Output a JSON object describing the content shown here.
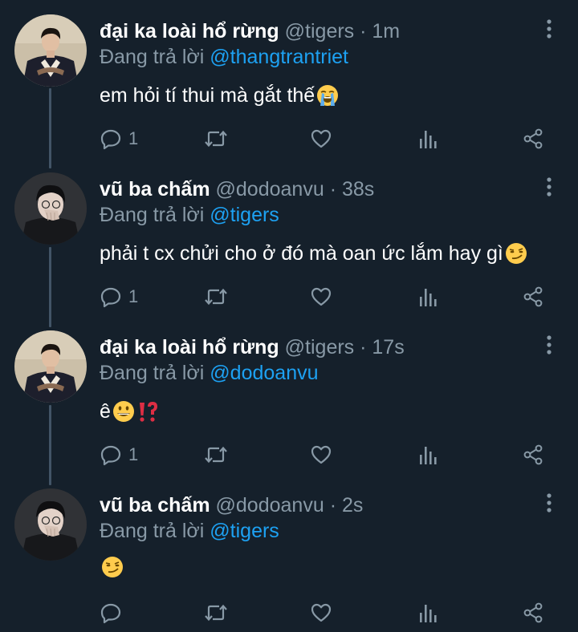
{
  "tweets": [
    {
      "name": "đại ka loài hổ rừng",
      "handle": "@tigers",
      "separator": "·",
      "time": "1m",
      "reply_prefix": "Đang trả lời",
      "reply_to": "@thangtrantriet",
      "text": "em hỏi tí thui mà gắt thế",
      "emojis": [
        "loudly-crying-face"
      ],
      "reply_count": "1",
      "avatar": "tiger-avatar"
    },
    {
      "name": "vũ ba chấm",
      "handle": "@dodoanvu",
      "separator": "·",
      "time": "38s",
      "reply_prefix": "Đang trả lời",
      "reply_to": "@tigers",
      "text": "phải t cx chửi cho ở đó mà oan ức lắm hay gì",
      "emojis": [
        "smirking-face"
      ],
      "reply_count": "1",
      "avatar": "vu-avatar"
    },
    {
      "name": "đại ka loài hổ rừng",
      "handle": "@tigers",
      "separator": "·",
      "time": "17s",
      "reply_prefix": "Đang trả lời",
      "reply_to": "@dodoanvu",
      "text": "ê",
      "emojis": [
        "grinning-face",
        "exclamation-question-mark"
      ],
      "reply_count": "1",
      "avatar": "tiger-avatar"
    },
    {
      "name": "vũ ba chấm",
      "handle": "@dodoanvu",
      "separator": "·",
      "time": "2s",
      "reply_prefix": "Đang trả lời",
      "reply_to": "@tigers",
      "text": "",
      "emojis": [
        "smirking-face"
      ],
      "reply_count": "",
      "avatar": "vu-avatar"
    }
  ],
  "icons": {
    "reply": "reply-icon",
    "retweet": "retweet-icon",
    "like": "heart-icon",
    "analytics": "analytics-icon",
    "share": "share-icon",
    "more": "more-vertical-icon"
  },
  "colors": {
    "background": "#15202b",
    "text": "#ffffff",
    "secondary_text": "#8899a6",
    "mention": "#1da1f2",
    "thread_line": "#425466"
  }
}
